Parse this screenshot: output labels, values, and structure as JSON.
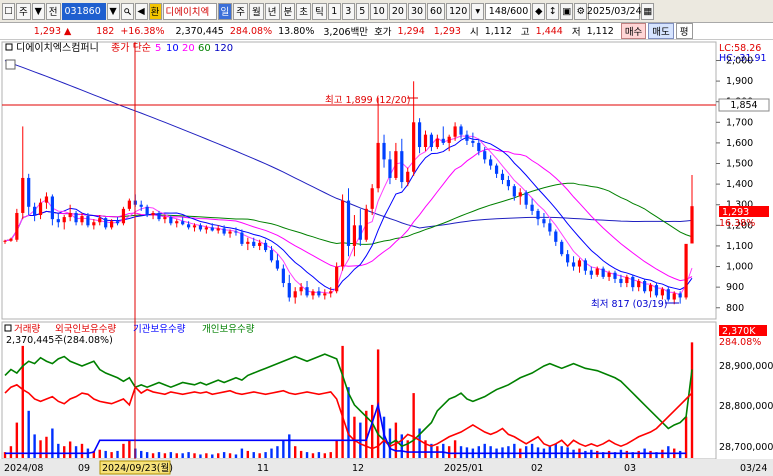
{
  "toolbar": {
    "market": "주",
    "market_dropdown": "▼",
    "prev_label": "전",
    "code": "031860",
    "code_dropdown": "▼",
    "search_icon": "magnifier-icon",
    "hwan_label": "환",
    "stock_name": "디에이치엑",
    "periods": [
      "일",
      "주",
      "월",
      "년",
      "분",
      "초",
      "틱"
    ],
    "minutes": [
      "1",
      "3",
      "5",
      "10",
      "20",
      "30",
      "60",
      "120"
    ],
    "count": "148/600",
    "date": "2025/03/24"
  },
  "info": {
    "price": "1,293",
    "arrow": "▲",
    "change": "182",
    "rate": "+16.38%",
    "volume": "2,370,445",
    "vol_rate": "284.08%",
    "turnover": "13.80%",
    "amount": "3,206백만",
    "bid_label": "호가",
    "ask": "1,294",
    "bid": "1,293",
    "open_label": "시",
    "open": "1,112",
    "high_label": "고",
    "high": "1,444",
    "low_label": "저",
    "low": "1,112",
    "buy_btn": "매수",
    "sell_btn": "매도",
    "eval_btn": "평"
  },
  "price_panel": {
    "legend_name": "디에이치엑스컴퍼니",
    "legend_type": "종가 단순",
    "ma": [
      {
        "period": "5",
        "color": "#ff00ff"
      },
      {
        "period": "10",
        "color": "#0000ff"
      },
      {
        "period": "20",
        "color": "#ff00ff"
      },
      {
        "period": "60",
        "color": "#008000"
      },
      {
        "period": "120",
        "color": "#0000c0"
      }
    ],
    "lc": "LC:58.26",
    "hc": "HC:-31.91",
    "y_ticks": [
      "2,000",
      "1,900",
      "1,800",
      "1,700",
      "1,600",
      "1,500",
      "1,400",
      "1,300",
      "1,200",
      "1,100",
      "1,000",
      "900",
      "800"
    ],
    "cursor_price": "1,854",
    "current_price_tag": "1,293",
    "current_rate_tag": "16.38%",
    "high_annotation": "최고 1,899 (12/20)",
    "low_annotation": "최저 817 (03/19)"
  },
  "volume_panel": {
    "legend": [
      {
        "label": "거래량",
        "color": "#ff0000"
      },
      {
        "label": "외국인보유수량",
        "color": "#ff0000"
      },
      {
        "label": "기관보유수량",
        "color": "#0000ff"
      },
      {
        "label": "개인보유수량",
        "color": "#008000"
      }
    ],
    "volume_line": "2,370,445주(284.08%)",
    "volume_tag": "2,370K",
    "volume_rate_tag": "284.08%",
    "y_ticks": [
      "28,900,000",
      "28,800,000",
      "28,700,000"
    ]
  },
  "x_axis": {
    "labels": [
      "2024/08",
      "09",
      "2024/09/23(월)",
      "11",
      "12",
      "2025/01",
      "02",
      "03",
      "03/24"
    ]
  },
  "chart_data": {
    "type": "candlestick",
    "y_range": [
      760,
      2080
    ],
    "price_highlights": {
      "high": 1899,
      "high_date": "12/20",
      "low": 817,
      "low_date": "03/19",
      "last": 1293
    },
    "candles": [
      [
        1120,
        1130,
        1110,
        1125
      ],
      [
        1125,
        1140,
        1120,
        1135
      ],
      [
        1130,
        1280,
        1120,
        1260
      ],
      [
        1260,
        1680,
        1230,
        1430
      ],
      [
        1430,
        1450,
        1250,
        1290
      ],
      [
        1290,
        1310,
        1220,
        1250
      ],
      [
        1250,
        1330,
        1230,
        1310
      ],
      [
        1310,
        1360,
        1280,
        1340
      ],
      [
        1340,
        1350,
        1200,
        1230
      ],
      [
        1230,
        1260,
        1190,
        1215
      ],
      [
        1215,
        1250,
        1180,
        1240
      ],
      [
        1240,
        1300,
        1220,
        1260
      ],
      [
        1260,
        1270,
        1200,
        1215
      ],
      [
        1215,
        1260,
        1200,
        1245
      ],
      [
        1245,
        1260,
        1190,
        1200
      ],
      [
        1200,
        1230,
        1180,
        1215
      ],
      [
        1215,
        1250,
        1200,
        1235
      ],
      [
        1235,
        1240,
        1180,
        1190
      ],
      [
        1190,
        1230,
        1180,
        1220
      ],
      [
        1220,
        1240,
        1200,
        1210
      ],
      [
        1210,
        1290,
        1200,
        1280
      ],
      [
        1280,
        1330,
        1270,
        1320
      ],
      [
        1320,
        1350,
        1290,
        1300
      ],
      [
        1300,
        1320,
        1270,
        1290
      ],
      [
        1290,
        1300,
        1240,
        1250
      ],
      [
        1250,
        1270,
        1230,
        1260
      ],
      [
        1260,
        1270,
        1220,
        1230
      ],
      [
        1230,
        1250,
        1210,
        1240
      ],
      [
        1240,
        1250,
        1200,
        1210
      ],
      [
        1210,
        1230,
        1190,
        1220
      ],
      [
        1220,
        1240,
        1200,
        1205
      ],
      [
        1205,
        1220,
        1180,
        1190
      ],
      [
        1190,
        1210,
        1170,
        1200
      ],
      [
        1200,
        1210,
        1170,
        1180
      ],
      [
        1180,
        1200,
        1160,
        1190
      ],
      [
        1190,
        1210,
        1170,
        1175
      ],
      [
        1175,
        1200,
        1160,
        1185
      ],
      [
        1185,
        1200,
        1150,
        1160
      ],
      [
        1160,
        1180,
        1140,
        1170
      ],
      [
        1170,
        1190,
        1150,
        1165
      ],
      [
        1165,
        1180,
        1100,
        1110
      ],
      [
        1110,
        1140,
        1080,
        1120
      ],
      [
        1120,
        1140,
        1090,
        1100
      ],
      [
        1100,
        1130,
        1080,
        1115
      ],
      [
        1115,
        1130,
        1070,
        1080
      ],
      [
        1080,
        1100,
        1020,
        1030
      ],
      [
        1030,
        1060,
        980,
        990
      ],
      [
        990,
        1010,
        900,
        920
      ],
      [
        920,
        960,
        830,
        850
      ],
      [
        850,
        900,
        820,
        880
      ],
      [
        880,
        920,
        860,
        900
      ],
      [
        900,
        930,
        850,
        860
      ],
      [
        860,
        890,
        840,
        880
      ],
      [
        880,
        900,
        850,
        860
      ],
      [
        860,
        890,
        840,
        870
      ],
      [
        870,
        900,
        850,
        880
      ],
      [
        880,
        1020,
        870,
        1000
      ],
      [
        1000,
        1350,
        980,
        1320
      ],
      [
        1320,
        1380,
        1050,
        1100
      ],
      [
        1100,
        1250,
        1050,
        1200
      ],
      [
        1200,
        1280,
        1100,
        1130
      ],
      [
        1130,
        1300,
        1120,
        1280
      ],
      [
        1280,
        1400,
        1250,
        1380
      ],
      [
        1380,
        1820,
        1360,
        1600
      ],
      [
        1600,
        1640,
        1480,
        1520
      ],
      [
        1520,
        1560,
        1400,
        1430
      ],
      [
        1430,
        1600,
        1420,
        1560
      ],
      [
        1560,
        1620,
        1380,
        1410
      ],
      [
        1410,
        1480,
        1390,
        1460
      ],
      [
        1460,
        1899,
        1440,
        1700
      ],
      [
        1700,
        1720,
        1550,
        1580
      ],
      [
        1580,
        1660,
        1560,
        1640
      ],
      [
        1640,
        1650,
        1560,
        1580
      ],
      [
        1580,
        1640,
        1570,
        1620
      ],
      [
        1620,
        1680,
        1590,
        1600
      ],
      [
        1600,
        1640,
        1560,
        1630
      ],
      [
        1630,
        1700,
        1610,
        1680
      ],
      [
        1680,
        1690,
        1620,
        1640
      ],
      [
        1640,
        1660,
        1590,
        1610
      ],
      [
        1610,
        1650,
        1580,
        1600
      ],
      [
        1600,
        1620,
        1540,
        1560
      ],
      [
        1560,
        1580,
        1500,
        1520
      ],
      [
        1520,
        1540,
        1470,
        1490
      ],
      [
        1490,
        1500,
        1430,
        1450
      ],
      [
        1450,
        1470,
        1400,
        1420
      ],
      [
        1420,
        1440,
        1370,
        1390
      ],
      [
        1390,
        1400,
        1320,
        1340
      ],
      [
        1340,
        1380,
        1300,
        1360
      ],
      [
        1360,
        1370,
        1280,
        1300
      ],
      [
        1300,
        1330,
        1250,
        1270
      ],
      [
        1270,
        1280,
        1200,
        1230
      ],
      [
        1230,
        1260,
        1190,
        1210
      ],
      [
        1210,
        1230,
        1150,
        1170
      ],
      [
        1170,
        1180,
        1100,
        1120
      ],
      [
        1120,
        1130,
        1050,
        1060
      ],
      [
        1060,
        1080,
        1000,
        1020
      ],
      [
        1020,
        1050,
        980,
        1000
      ],
      [
        1000,
        1040,
        970,
        1030
      ],
      [
        1030,
        1040,
        960,
        980
      ],
      [
        980,
        1000,
        940,
        960
      ],
      [
        960,
        1000,
        950,
        990
      ],
      [
        990,
        1000,
        940,
        950
      ],
      [
        950,
        980,
        930,
        970
      ],
      [
        970,
        980,
        920,
        940
      ],
      [
        940,
        960,
        900,
        920
      ],
      [
        920,
        960,
        900,
        950
      ],
      [
        950,
        960,
        880,
        900
      ],
      [
        900,
        940,
        880,
        930
      ],
      [
        930,
        940,
        870,
        880
      ],
      [
        880,
        920,
        850,
        910
      ],
      [
        910,
        920,
        850,
        860
      ],
      [
        860,
        900,
        840,
        890
      ],
      [
        890,
        900,
        830,
        840
      ],
      [
        840,
        880,
        817,
        870
      ],
      [
        870,
        880,
        820,
        850
      ],
      [
        850,
        1000,
        840,
        1110
      ],
      [
        1112,
        1444,
        1112,
        1293
      ]
    ],
    "volume": [
      0.05,
      0.1,
      0.3,
      0.95,
      0.4,
      0.2,
      0.15,
      0.18,
      0.25,
      0.12,
      0.1,
      0.14,
      0.1,
      0.12,
      0.08,
      0.06,
      0.07,
      0.06,
      0.05,
      0.06,
      0.12,
      0.15,
      0.08,
      0.06,
      0.05,
      0.04,
      0.05,
      0.04,
      0.05,
      0.04,
      0.04,
      0.05,
      0.04,
      0.03,
      0.04,
      0.03,
      0.04,
      0.05,
      0.04,
      0.03,
      0.08,
      0.06,
      0.05,
      0.04,
      0.05,
      0.08,
      0.1,
      0.15,
      0.2,
      0.1,
      0.06,
      0.05,
      0.04,
      0.05,
      0.04,
      0.05,
      0.15,
      0.95,
      0.6,
      0.35,
      0.3,
      0.4,
      0.45,
      0.92,
      0.35,
      0.25,
      0.3,
      0.2,
      0.15,
      0.55,
      0.25,
      0.15,
      0.12,
      0.1,
      0.12,
      0.1,
      0.15,
      0.1,
      0.09,
      0.08,
      0.1,
      0.12,
      0.1,
      0.08,
      0.09,
      0.1,
      0.12,
      0.08,
      0.1,
      0.12,
      0.09,
      0.08,
      0.1,
      0.12,
      0.1,
      0.09,
      0.07,
      0.08,
      0.06,
      0.07,
      0.06,
      0.05,
      0.06,
      0.05,
      0.07,
      0.06,
      0.05,
      0.06,
      0.08,
      0.06,
      0.05,
      0.07,
      0.1,
      0.08,
      0.06,
      0.35,
      0.98
    ],
    "foreign_holding": [
      0.55,
      0.6,
      0.62,
      0.58,
      0.55,
      0.5,
      0.48,
      0.5,
      0.52,
      0.48,
      0.46,
      0.5,
      0.52,
      0.55,
      0.54,
      0.5,
      0.48,
      0.47,
      0.46,
      0.48,
      0.5,
      0.45,
      0.6,
      0.55,
      0.58,
      0.56,
      0.55,
      0.54,
      0.56,
      0.55,
      0.54,
      0.55,
      0.56,
      0.55,
      0.56,
      0.54,
      0.55,
      0.56,
      0.57,
      0.55,
      0.54,
      0.55,
      0.56,
      0.55,
      0.54,
      0.55,
      0.56,
      0.57,
      0.55,
      0.54,
      0.55,
      0.56,
      0.55,
      0.54,
      0.55,
      0.56,
      0.5,
      0.35,
      0.2,
      0.15,
      0.12,
      0.1,
      0.08,
      0.1,
      0.15,
      0.1,
      0.12,
      0.15,
      0.2,
      0.18,
      0.15,
      0.12,
      0.1,
      0.12,
      0.15,
      0.18,
      0.2,
      0.22,
      0.25,
      0.28,
      0.25,
      0.22,
      0.2,
      0.22,
      0.25,
      0.2,
      0.18,
      0.15,
      0.12,
      0.15,
      0.18,
      0.12,
      0.1,
      0.12,
      0.15,
      0.1,
      0.15,
      0.12,
      0.1,
      0.12,
      0.1,
      0.12,
      0.15,
      0.12,
      0.1,
      0.12,
      0.15,
      0.18,
      0.2,
      0.22,
      0.25,
      0.3,
      0.35,
      0.4,
      0.45,
      0.5,
      0.55
    ],
    "institution_holding": [
      0.04,
      0.04,
      0.04,
      0.04,
      0.04,
      0.04,
      0.04,
      0.04,
      0.04,
      0.04,
      0.04,
      0.04,
      0.04,
      0.04,
      0.04,
      0.05,
      0.15,
      0.15,
      0.15,
      0.15,
      0.15,
      0.15,
      0.15,
      0.15,
      0.15,
      0.15,
      0.15,
      0.15,
      0.15,
      0.15,
      0.15,
      0.15,
      0.15,
      0.15,
      0.15,
      0.15,
      0.15,
      0.15,
      0.15,
      0.15,
      0.15,
      0.15,
      0.15,
      0.15,
      0.15,
      0.15,
      0.15,
      0.15,
      0.15,
      0.15,
      0.15,
      0.15,
      0.15,
      0.15,
      0.15,
      0.15,
      0.15,
      0.15,
      0.15,
      0.15,
      0.15,
      0.15,
      0.3,
      0.45,
      0.2,
      0.08,
      0.06,
      0.06,
      0.05,
      0.05,
      0.05,
      0.05,
      0.05,
      0.05,
      0.05,
      0.04,
      0.04,
      0.04,
      0.04,
      0.04,
      0.04,
      0.04,
      0.04,
      0.04,
      0.04,
      0.04,
      0.04,
      0.04,
      0.04,
      0.04,
      0.04,
      0.04,
      0.04,
      0.04,
      0.04,
      0.04,
      0.04,
      0.04,
      0.04,
      0.04,
      0.04,
      0.04,
      0.04,
      0.04,
      0.04,
      0.04,
      0.04,
      0.04,
      0.04,
      0.04,
      0.04,
      0.04,
      0.04,
      0.04,
      0.04,
      0.04
    ],
    "individual_holding": [
      0.7,
      0.75,
      0.72,
      0.78,
      0.82,
      0.8,
      0.85,
      0.82,
      0.8,
      0.84,
      0.86,
      0.82,
      0.8,
      0.78,
      0.8,
      0.82,
      0.75,
      0.72,
      0.7,
      0.68,
      0.65,
      0.68,
      0.6,
      0.62,
      0.6,
      0.62,
      0.64,
      0.62,
      0.6,
      0.62,
      0.64,
      0.63,
      0.62,
      0.64,
      0.62,
      0.64,
      0.66,
      0.64,
      0.66,
      0.68,
      0.66,
      0.7,
      0.72,
      0.74,
      0.76,
      0.78,
      0.8,
      0.82,
      0.84,
      0.86,
      0.84,
      0.82,
      0.84,
      0.86,
      0.88,
      0.86,
      0.84,
      0.7,
      0.55,
      0.45,
      0.4,
      0.35,
      0.3,
      0.2,
      0.15,
      0.12,
      0.15,
      0.1,
      0.12,
      0.15,
      0.2,
      0.25,
      0.3,
      0.4,
      0.45,
      0.5,
      0.52,
      0.55,
      0.5,
      0.48,
      0.5,
      0.52,
      0.55,
      0.58,
      0.6,
      0.62,
      0.65,
      0.68,
      0.7,
      0.72,
      0.75,
      0.78,
      0.8,
      0.78,
      0.76,
      0.78,
      0.8,
      0.78,
      0.76,
      0.75,
      0.74,
      0.72,
      0.7,
      0.68,
      0.65,
      0.6,
      0.55,
      0.5,
      0.45,
      0.4,
      0.35,
      0.3,
      0.25,
      0.28,
      0.3,
      0.35,
      0.75
    ]
  }
}
